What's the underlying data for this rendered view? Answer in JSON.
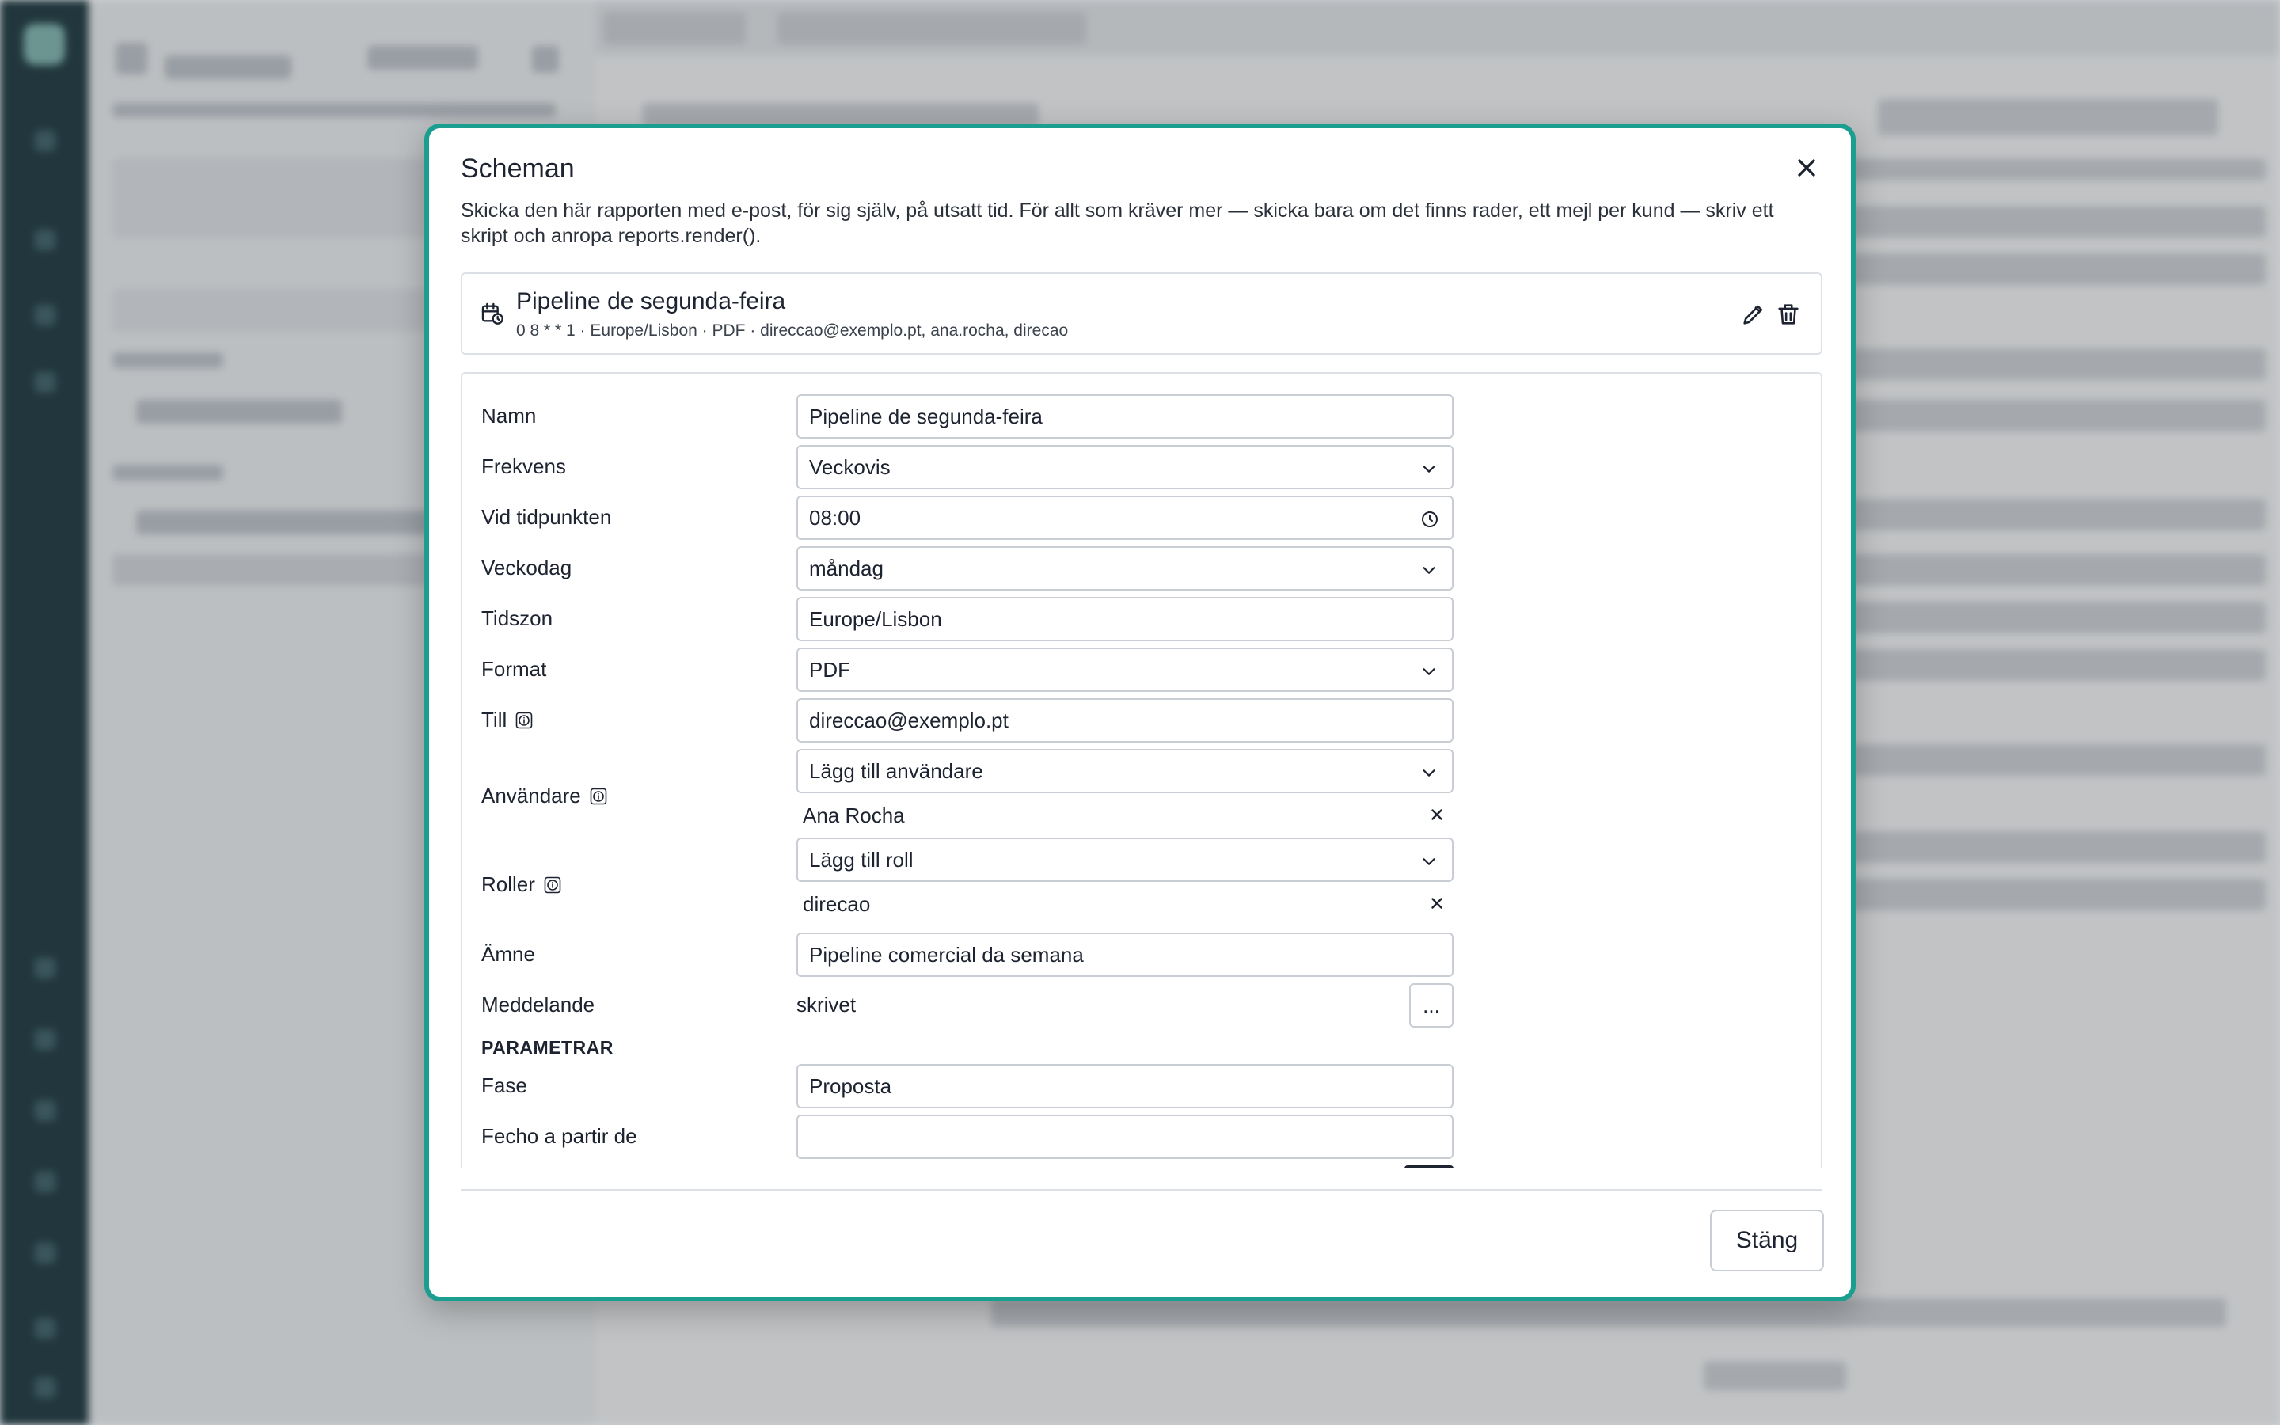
{
  "dialog": {
    "title": "Scheman",
    "description": "Skicka den här rapporten med e-post, för sig själv, på utsatt tid. För allt som kräver mer — skicka bara om det finns rader, ett mejl per kund — skriv ett skript och anropa reports.render().",
    "close_label": "Stäng"
  },
  "schedule": {
    "name": "Pipeline de segunda-feira",
    "meta": "0 8 * * 1 · Europe/Lisbon · PDF · direccao@exemplo.pt, ana.rocha, direcao"
  },
  "form": {
    "name": {
      "label": "Namn",
      "value": "Pipeline de segunda-feira"
    },
    "frequency": {
      "label": "Frekvens",
      "value": "Veckovis"
    },
    "time": {
      "label": "Vid tidpunkten",
      "value": "08:00"
    },
    "weekday": {
      "label": "Veckodag",
      "value": "måndag"
    },
    "timezone": {
      "label": "Tidszon",
      "value": "Europe/Lisbon"
    },
    "format": {
      "label": "Format",
      "value": "PDF"
    },
    "to": {
      "label": "Till",
      "value": "direccao@exemplo.pt"
    },
    "users": {
      "label": "Användare",
      "placeholder": "Lägg till användare",
      "items": [
        "Ana Rocha"
      ]
    },
    "roles": {
      "label": "Roller",
      "placeholder": "Lägg till roll",
      "items": [
        "direcao"
      ]
    },
    "subject": {
      "label": "Ämne",
      "value": "Pipeline comercial da semana"
    },
    "message": {
      "label": "Meddelande",
      "value": "skrivet",
      "button": "..."
    },
    "params_heading": "PARAMETRAR",
    "fase": {
      "label": "Fase",
      "value": "Proposta"
    },
    "fecho": {
      "label": "Fecho a partir de",
      "value": ""
    }
  },
  "colors": {
    "accent": "#1a9e8f",
    "rail": "#1f3a40"
  }
}
